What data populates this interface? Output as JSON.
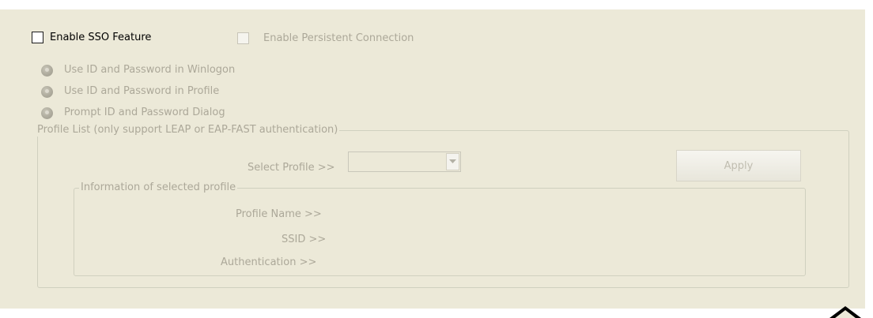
{
  "sso": {
    "enable_label": "Enable SSO Feature",
    "persistent_label": "Enable Persistent Connection"
  },
  "options": [
    {
      "label": "Use ID and Password in Winlogon"
    },
    {
      "label": "Use ID and Password in Profile"
    },
    {
      "label": "Prompt ID and Password Dialog"
    }
  ],
  "profile_list": {
    "legend": "Profile List (only support LEAP or EAP-FAST authentication)",
    "select_label": "Select Profile >>",
    "select_value": "",
    "apply_label": "Apply"
  },
  "info": {
    "legend": "Information of selected profile",
    "profile_name_label": "Profile Name >>",
    "ssid_label": "SSID >>",
    "authentication_label": "Authentication >>"
  },
  "icons": {
    "dropdown": "chevron-down-icon",
    "corner": "triangle-up-icon"
  }
}
